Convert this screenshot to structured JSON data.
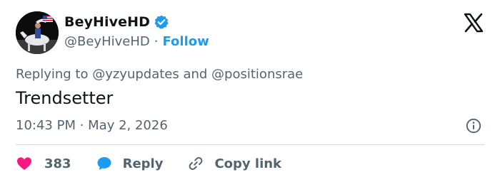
{
  "author": {
    "display_name": "BeyHiveHD",
    "handle": "@BeyHiveHD",
    "separator": "·",
    "follow_label": "Follow"
  },
  "tweet": {
    "replying_to": "Replying to @yzyupdates and @positionsrae",
    "text": "Trendsetter",
    "timestamp": "10:43 PM · May 2, 2026"
  },
  "actions": {
    "like_count": "383",
    "reply_label": "Reply",
    "copy_link_label": "Copy link"
  },
  "icons": {
    "verified": "verified-badge-icon",
    "platform": "x-logo-icon",
    "info": "info-icon",
    "like": "heart-icon",
    "reply": "speech-bubble-icon",
    "copy": "link-icon"
  },
  "colors": {
    "accent": "#1d9bf0",
    "like": "#f91880",
    "secondary_text": "#536471",
    "primary_text": "#0f1419",
    "divider": "#cfd9de"
  }
}
